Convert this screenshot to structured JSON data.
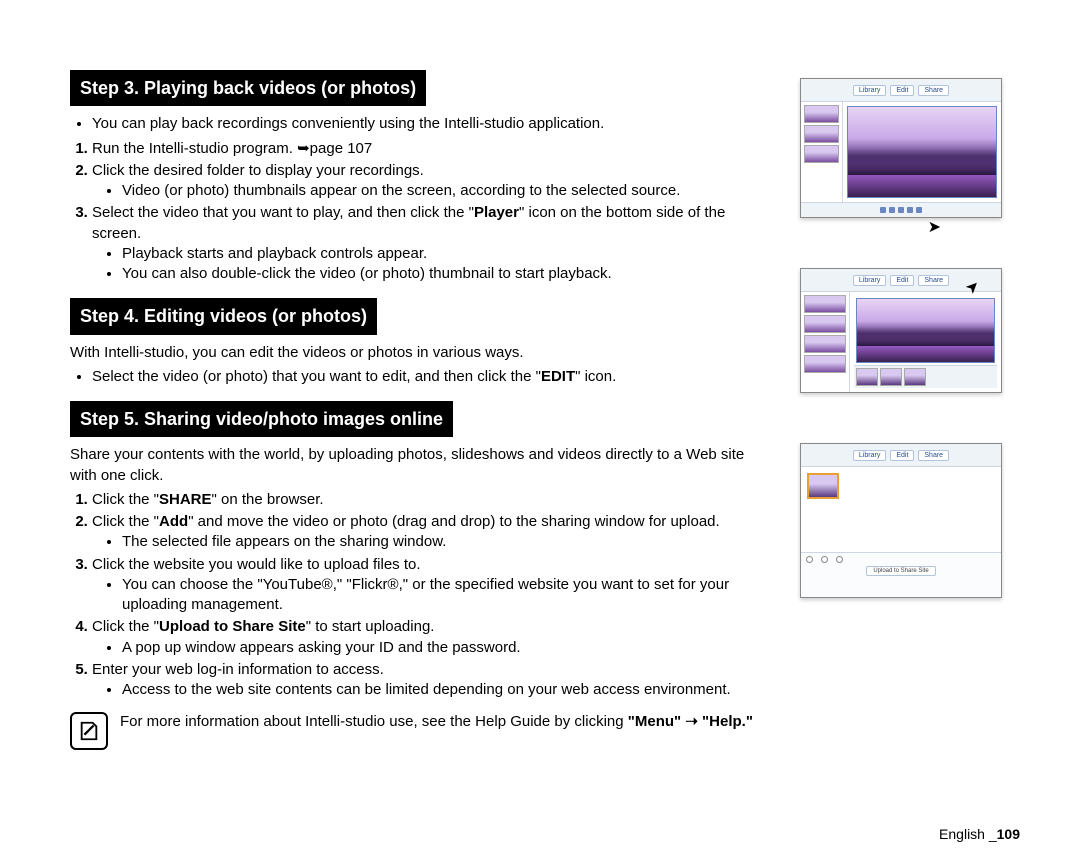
{
  "step3": {
    "heading": "Step 3. Playing back videos (or photos)",
    "intro_bullet": "You can play back recordings conveniently using the Intelli-studio application.",
    "item1": "Run the Intelli-studio program. ➥page 107",
    "item2": "Click the desired folder to display your recordings.",
    "item2_sub": "Video (or photo) thumbnails appear on the screen, according to the selected source.",
    "item3_pre": "Select the video that you want to play, and then click the \"",
    "item3_bold": "Player",
    "item3_post": "\" icon on the bottom side of the screen.",
    "item3_sub1": "Playback starts and playback controls appear.",
    "item3_sub2": "You can also double-click the video (or photo) thumbnail to start playback."
  },
  "step4": {
    "heading": "Step 4. Editing videos (or photos)",
    "intro": "With Intelli-studio, you can edit the videos or photos in various ways.",
    "bullet_pre": "Select the video (or photo) that you want to edit, and then click the \"",
    "bullet_bold": "EDIT",
    "bullet_post": "\" icon."
  },
  "step5": {
    "heading": "Step 5. Sharing video/photo images online",
    "intro": "Share your contents with the world, by uploading photos, slideshows and videos directly to a Web site with one click.",
    "item1_pre": "Click the \"",
    "item1_bold": "SHARE",
    "item1_post": "\" on the browser.",
    "item2_pre": "Click the \"",
    "item2_bold": "Add",
    "item2_post": "\" and move the video or photo (drag and drop) to the sharing window for upload.",
    "item2_sub": "The selected file appears on the sharing window.",
    "item3": "Click the website you would like to upload files to.",
    "item3_sub": "You can choose the \"YouTube®,\" \"Flickr®,\" or the specified website you want to set for your uploading management.",
    "item4_pre": "Click the \"",
    "item4_bold": "Upload to Share Site",
    "item4_post": "\" to start uploading.",
    "item4_sub": "A pop up window appears asking your ID and the password.",
    "item5": "Enter your web log-in information to access.",
    "item5_sub": "Access to the web site contents can be limited depending on your web access environment."
  },
  "note": {
    "text_pre": "For more information about Intelli-studio use, see the Help Guide by clicking ",
    "text_bold": "\"Menu\" ➝ \"Help.\""
  },
  "screenshots": {
    "tabs": {
      "library": "Library",
      "edit": "Edit",
      "share": "Share"
    },
    "upload_btn": "Upload to Share Site"
  },
  "footer": {
    "lang": "English _",
    "page": "109"
  }
}
